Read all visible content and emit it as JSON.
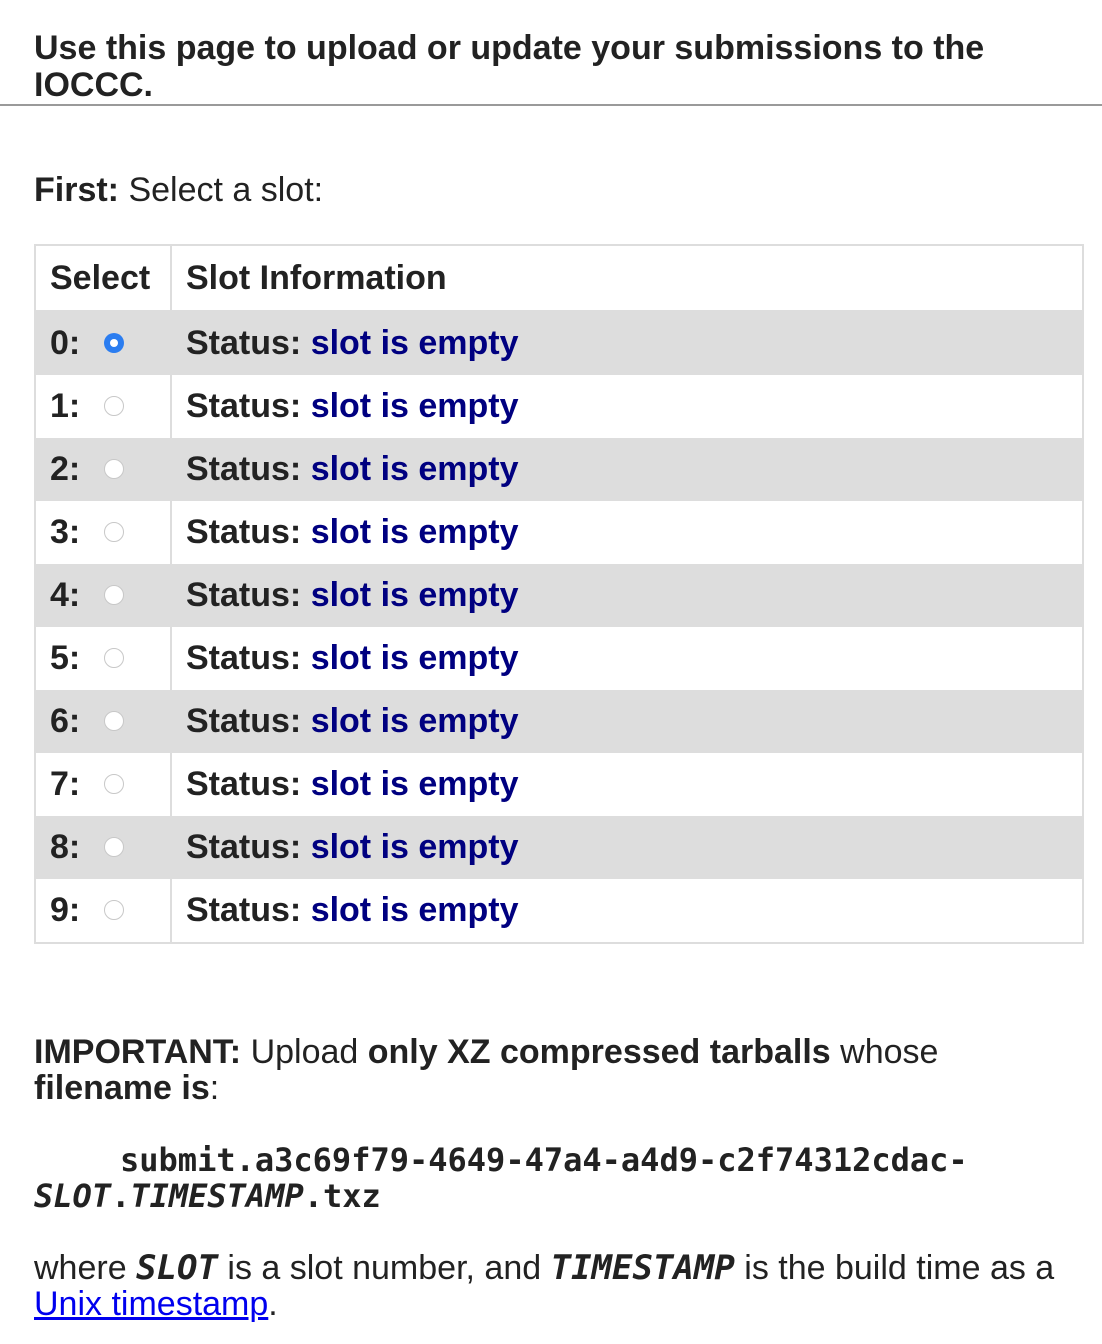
{
  "header": {
    "title": "Use this page to upload or update your submissions to the IOCCC."
  },
  "first": {
    "label": "First:",
    "text": "Select a slot:"
  },
  "table": {
    "headers": {
      "select": "Select",
      "info": "Slot Information"
    },
    "status_label": "Status:",
    "rows": [
      {
        "num": "0:",
        "selected": true,
        "status": "slot is empty"
      },
      {
        "num": "1:",
        "selected": false,
        "status": "slot is empty"
      },
      {
        "num": "2:",
        "selected": false,
        "status": "slot is empty"
      },
      {
        "num": "3:",
        "selected": false,
        "status": "slot is empty"
      },
      {
        "num": "4:",
        "selected": false,
        "status": "slot is empty"
      },
      {
        "num": "5:",
        "selected": false,
        "status": "slot is empty"
      },
      {
        "num": "6:",
        "selected": false,
        "status": "slot is empty"
      },
      {
        "num": "7:",
        "selected": false,
        "status": "slot is empty"
      },
      {
        "num": "8:",
        "selected": false,
        "status": "slot is empty"
      },
      {
        "num": "9:",
        "selected": false,
        "status": "slot is empty"
      }
    ]
  },
  "important": {
    "label": "IMPORTANT:",
    "text1": " Upload ",
    "bold1": "only XZ compressed tarballs",
    "text2": " whose ",
    "bold2": "filename is",
    "text3": ":"
  },
  "filename": {
    "prefix": "submit.a3c69f79-4649-47a4-a4d9-c2f74312cdac-",
    "slot": "SLOT",
    "dot1": ".",
    "timestamp": "TIMESTAMP",
    "suffix": ".txz"
  },
  "where": {
    "text1": "where ",
    "slot": "SLOT",
    "text2": " is a slot number, and ",
    "timestamp": "TIMESTAMP",
    "text3": " is the build time as a ",
    "link": "Unix timestamp",
    "text4": "."
  },
  "colors": {
    "status_value": "#000080",
    "radio_selected": "#2b7df0",
    "row_stripe": "#dddddd",
    "link": "#0000ee"
  }
}
